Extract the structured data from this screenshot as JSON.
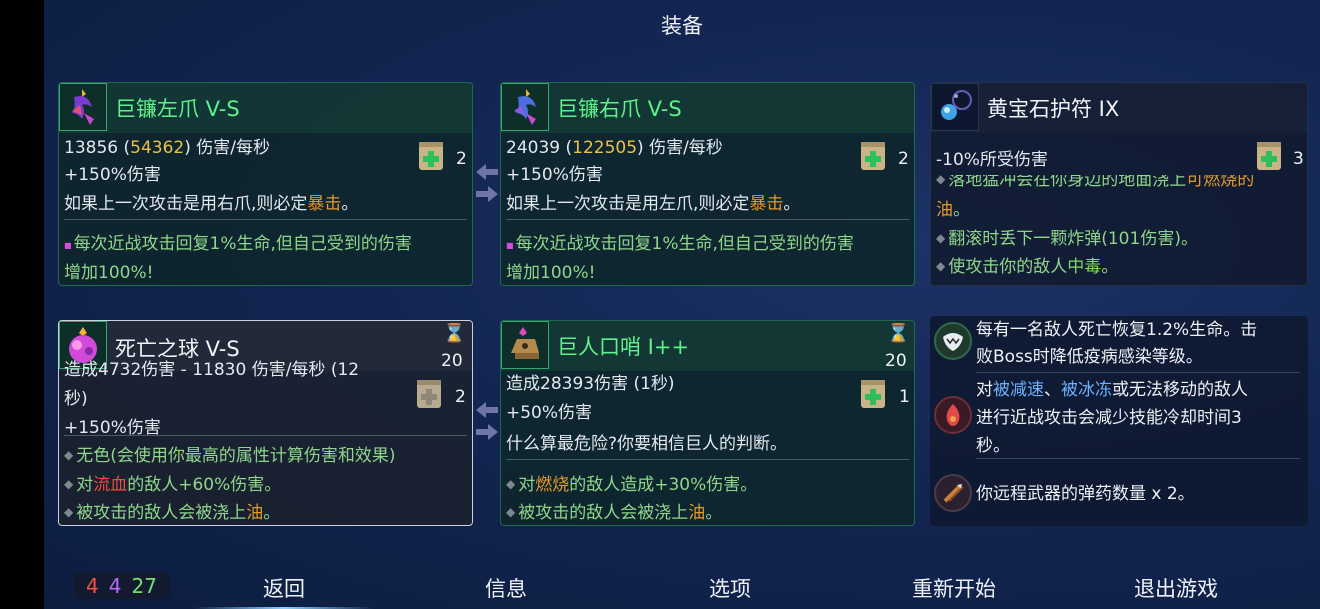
{
  "title": "装备",
  "cards": {
    "left_claw": {
      "name": "巨镰左爪 V-S",
      "dps_base": "13856 (",
      "dps_max": "54362",
      "dps_suffix": ") 伤害/每秒",
      "bonus": "+150%伤害",
      "scroll_count": "2",
      "desc_prefix": "如果上一次攻击是用右爪,则必定",
      "desc_highlight": "暴击",
      "desc_suffix": "。",
      "affix_line1": "每次近战攻击回复1%生命,但自己受到的伤害",
      "affix_line2": "增加100%!"
    },
    "right_claw": {
      "name": "巨镰右爪 V-S",
      "dps_base": "24039 (",
      "dps_max": "122505",
      "dps_suffix": ") 伤害/每秒",
      "bonus": "+150%伤害",
      "scroll_count": "2",
      "desc_prefix": "如果上一次攻击是用左爪,则必定",
      "desc_highlight": "暴击",
      "desc_suffix": "。",
      "affix_line1": "每次近战攻击回复1%生命,但自己受到的伤害",
      "affix_line2": "增加100%!"
    },
    "amulet": {
      "name": "黄宝石护符 IX",
      "stat": "-10%所受伤害",
      "scroll_count": "3",
      "line_cut_prefix": "落地猛冲会在你身边的地面浇上",
      "line_cut_highlight": "可燃烧的",
      "line_oil": "油",
      "line_oil_suffix": "。",
      "line_bomb": "翻滚时丢下一颗炸弹(101伤害)。",
      "line_poison_prefix": "使攻击你的敌人",
      "line_poison": "中毒",
      "line_poison_suffix": "。"
    },
    "death_orb": {
      "name": "死亡之球 V-S",
      "cooldown": "20",
      "dmg_line1": "造成4732伤害 - 11830 伤害/每秒 (12",
      "dmg_line2": "秒)",
      "scroll_count": "2",
      "bonus": "+150%伤害",
      "colorless": "无色(会使用你最高的属性计算伤害和效果)",
      "bleed_prefix": "对",
      "bleed_word": "流血",
      "bleed_suffix": "的敌人+60%伤害。",
      "oil_prefix": "被攻击的敌人会被浇上",
      "oil_word": "油",
      "oil_suffix": "。"
    },
    "giant_whistle": {
      "name": "巨人口哨 I++",
      "cooldown": "20",
      "dmg_line": "造成28393伤害 (1秒)",
      "scroll_count": "1",
      "bonus": "+50%伤害",
      "desc": "什么算最危险?你要相信巨人的判断。",
      "burn_prefix": "对",
      "burn_word": "燃烧",
      "burn_suffix": "的敌人造成+30%伤害。",
      "oil_prefix": "被攻击的敌人会被浇上",
      "oil_word": "油",
      "oil_suffix": "。"
    }
  },
  "mutations": {
    "m1_line1": "每有一名敌人死亡恢复1.2%生命。击",
    "m1_line2": "败Boss时降低疫病感染等级。",
    "m2_prefix": "对",
    "m2_slow": "被减速",
    "m2_sep": "、",
    "m2_frozen": "被冰冻",
    "m2_rest": "或无法移动的敌人",
    "m2_line2": "进行近战攻击会减少技能冷却时间3",
    "m2_line3": "秒。",
    "m3_line": "你远程武器的弹药数量 x 2。"
  },
  "counters": {
    "red": "4",
    "purple": "4",
    "green": "27"
  },
  "nav": {
    "back": "返回",
    "info": "信息",
    "options": "选项",
    "restart": "重新开始",
    "quit": "退出游戏"
  },
  "colors": {
    "weapon_name": "#5ef28b",
    "yellow": "#e9c34a",
    "orange": "#e39a2c",
    "red": "#ef4b3d",
    "blue": "#6cb0ff",
    "green": "#7edc63",
    "purple": "#b46cf2"
  }
}
